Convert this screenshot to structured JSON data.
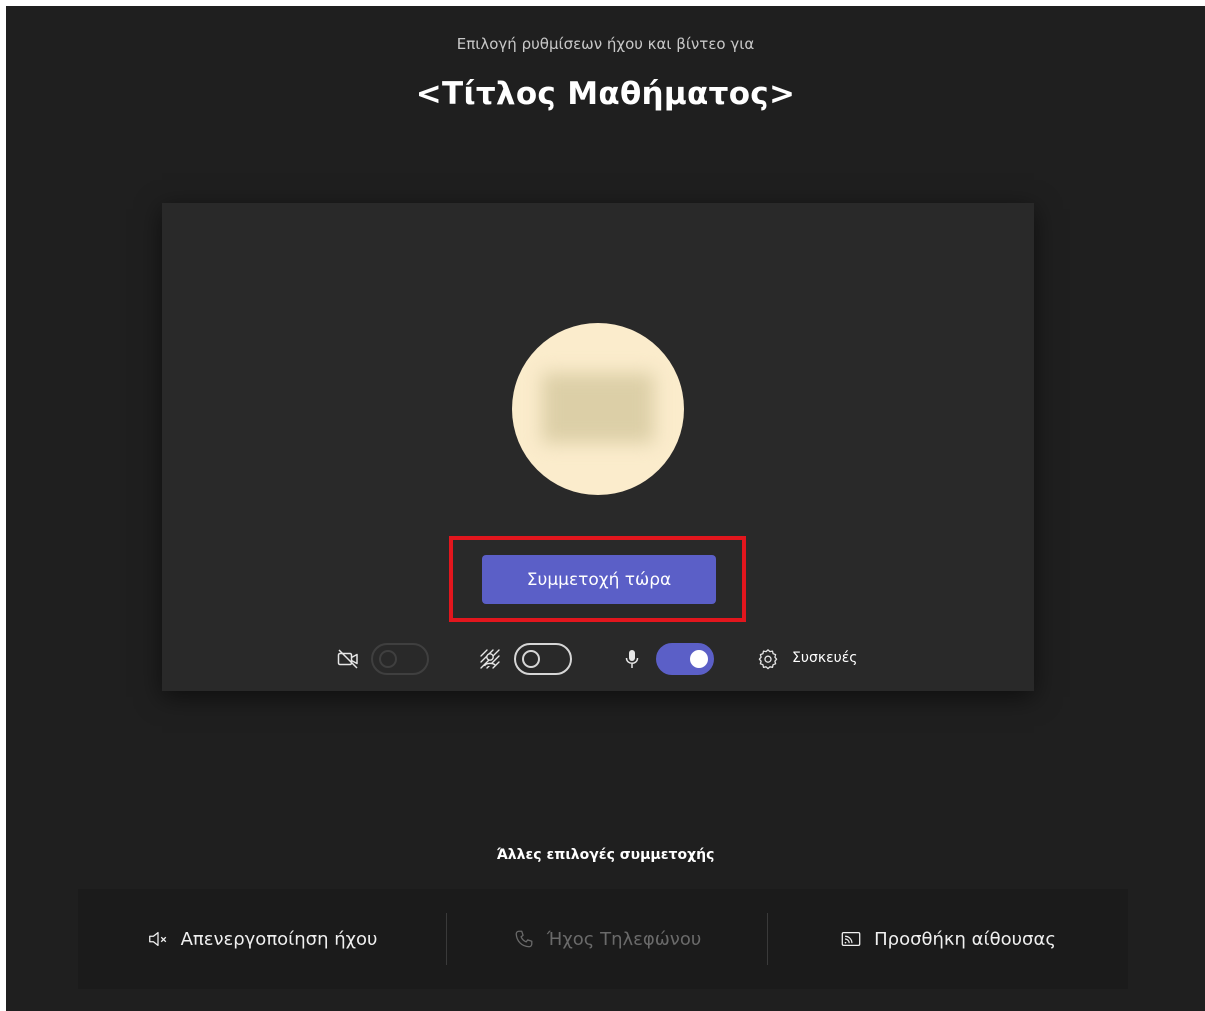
{
  "header": {
    "subtitle": "Επιλογή ρυθμίσεων ήχου και βίντεο για",
    "title": "<Τίτλος Μαθήματος>"
  },
  "preview": {
    "join_button_label": "Συμμετοχή τώρα",
    "avatar_color": "#fbeccc"
  },
  "controls": {
    "camera": {
      "icon": "camera-off-icon",
      "enabled": false
    },
    "background_effects": {
      "icon": "background-effects-icon",
      "enabled": false
    },
    "microphone": {
      "icon": "microphone-icon",
      "enabled": true
    },
    "devices": {
      "icon": "gear-icon",
      "label": "Συσκευές"
    }
  },
  "other_options": {
    "heading": "Άλλες επιλογές συμμετοχής",
    "items": [
      {
        "icon": "speaker-muted-icon",
        "label": "Απενεργοποίηση ήχου",
        "disabled": false
      },
      {
        "icon": "phone-icon",
        "label": "Ήχος Τηλεφώνου",
        "disabled": true
      },
      {
        "icon": "cast-icon",
        "label": "Προσθήκη αίθουσας",
        "disabled": false
      }
    ]
  },
  "colors": {
    "accent": "#5b5fc7",
    "highlight": "#e2161d",
    "background": "#1f1f1f"
  }
}
